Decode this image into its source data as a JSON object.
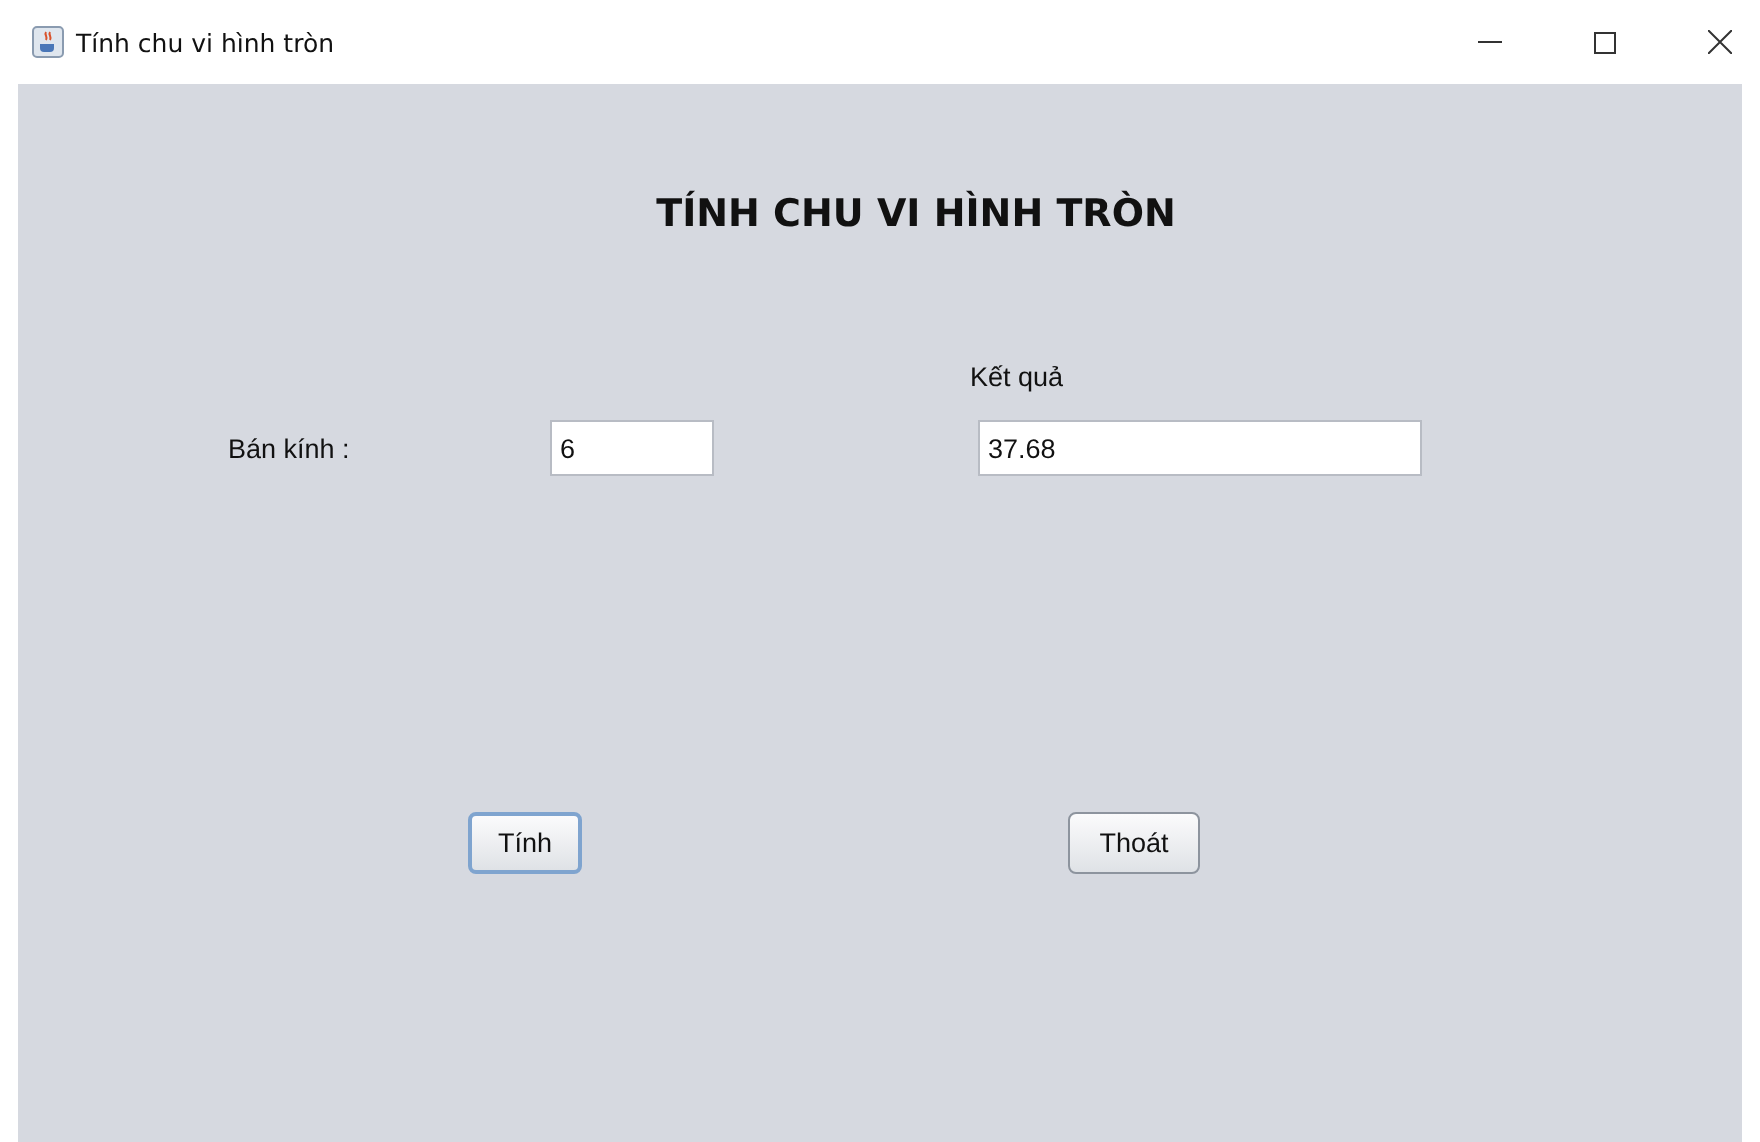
{
  "window": {
    "title": "Tính chu vi hình tròn"
  },
  "heading": "TÍNH CHU VI HÌNH TRÒN",
  "result_label": "Kết quả",
  "radius": {
    "label": "Bán kính :",
    "value": "6"
  },
  "result": {
    "value": "37.68"
  },
  "buttons": [
    {
      "label": "Tính",
      "focused": true
    },
    {
      "label": "Thoát",
      "focused": false
    }
  ]
}
